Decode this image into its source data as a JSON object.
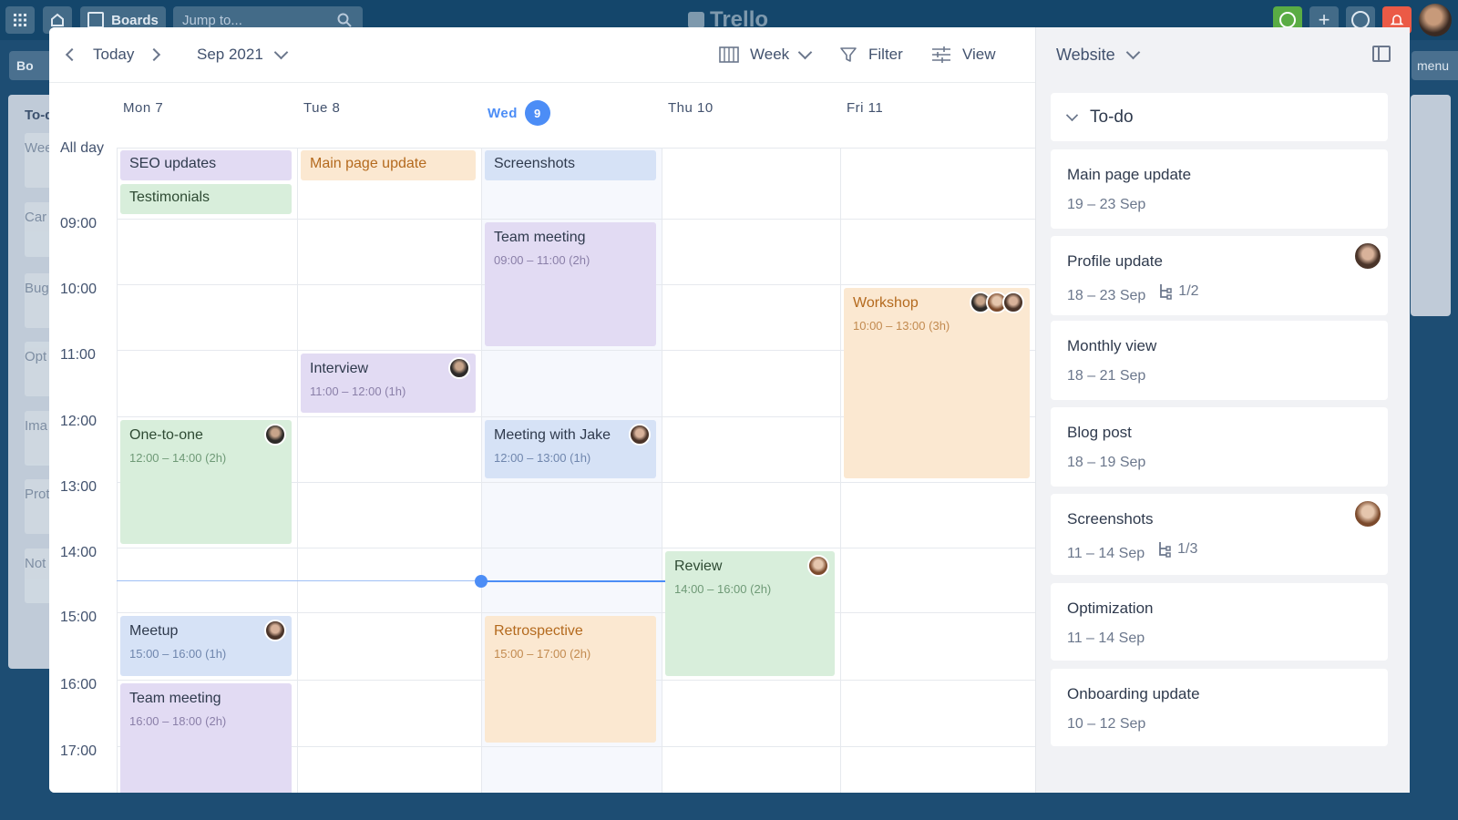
{
  "topbar": {
    "boards_label": "Boards",
    "search_placeholder": "Jump to...",
    "logo_text": "Trello"
  },
  "background": {
    "list_title": "To-d",
    "list_cards": [
      "Wee",
      "Car",
      "Bug",
      "Opt",
      "Ima",
      "Prot",
      "Not"
    ],
    "board_tab": "Bo",
    "menu_label": "menu"
  },
  "header": {
    "today_label": "Today",
    "month_label": "Sep 2021",
    "view_mode_label": "Week",
    "filter_label": "Filter",
    "view_label": "View"
  },
  "days": [
    {
      "label": "Mon 7"
    },
    {
      "label": "Tue 8"
    },
    {
      "label": "Wed",
      "badge": "9",
      "today": true
    },
    {
      "label": "Thu 10"
    },
    {
      "label": "Fri 11"
    }
  ],
  "allday_label": "All day",
  "hours": [
    "09:00",
    "10:00",
    "11:00",
    "12:00",
    "13:00",
    "14:00",
    "15:00",
    "16:00",
    "17:00"
  ],
  "allday_events": [
    {
      "title": "SEO updates",
      "day": 0,
      "row": 0,
      "color": "purple"
    },
    {
      "title": "Testimonials",
      "day": 0,
      "row": 1,
      "color": "green"
    },
    {
      "title": "Main page update",
      "day": 1,
      "row": 0,
      "color": "orange"
    },
    {
      "title": "Screenshots",
      "day": 2,
      "row": 0,
      "color": "blue"
    }
  ],
  "events": [
    {
      "title": "Team meeting",
      "time": "09:00 – 11:00 (2h)",
      "day": 2,
      "start": 9,
      "end": 11,
      "color": "purple",
      "avatars": []
    },
    {
      "title": "Workshop",
      "time": "10:00 – 13:00 (3h)",
      "day": 4,
      "start": 10,
      "end": 13,
      "color": "orange",
      "avatars": [
        "av3",
        "av2",
        "av1"
      ]
    },
    {
      "title": "Interview",
      "time": "11:00 – 12:00 (1h)",
      "day": 1,
      "start": 11,
      "end": 12,
      "color": "purple",
      "avatars": [
        "av3"
      ]
    },
    {
      "title": "One-to-one",
      "time": "12:00 – 14:00 (2h)",
      "day": 0,
      "start": 12,
      "end": 14,
      "color": "green",
      "avatars": [
        "av3"
      ]
    },
    {
      "title": "Meeting with Jake",
      "time": "12:00 – 13:00 (1h)",
      "day": 2,
      "start": 12,
      "end": 13,
      "color": "blue",
      "avatars": [
        "av1"
      ]
    },
    {
      "title": "Review",
      "time": "14:00 – 16:00 (2h)",
      "day": 3,
      "start": 14,
      "end": 16,
      "color": "green",
      "avatars": [
        "av2"
      ]
    },
    {
      "title": "Meetup",
      "time": "15:00 – 16:00 (1h)",
      "day": 0,
      "start": 15,
      "end": 16,
      "color": "blue",
      "avatars": [
        "av1"
      ]
    },
    {
      "title": "Retrospective",
      "time": "15:00 – 17:00 (2h)",
      "day": 2,
      "start": 15,
      "end": 17,
      "color": "orange",
      "avatars": []
    },
    {
      "title": "Team meeting",
      "time": "16:00 – 18:00 (2h)",
      "day": 0,
      "start": 16,
      "end": 18,
      "color": "purple",
      "avatars": []
    }
  ],
  "now": {
    "day": 2,
    "hour": 14.5
  },
  "side": {
    "board_name": "Website",
    "list_name": "To-do",
    "cards": [
      {
        "title": "Main page update",
        "dates": "19 – 23 Sep"
      },
      {
        "title": "Profile update",
        "dates": "18 – 23 Sep",
        "subtasks": "1/2",
        "avatar": "av1"
      },
      {
        "title": "Monthly view",
        "dates": "18 – 21 Sep"
      },
      {
        "title": "Blog post",
        "dates": "18 – 19 Sep"
      },
      {
        "title": "Screenshots",
        "dates": "11 – 14 Sep",
        "subtasks": "1/3",
        "avatar": "av2"
      },
      {
        "title": "Optimization",
        "dates": "11 – 14 Sep"
      },
      {
        "title": "Onboarding update",
        "dates": "10 – 12 Sep"
      }
    ]
  }
}
